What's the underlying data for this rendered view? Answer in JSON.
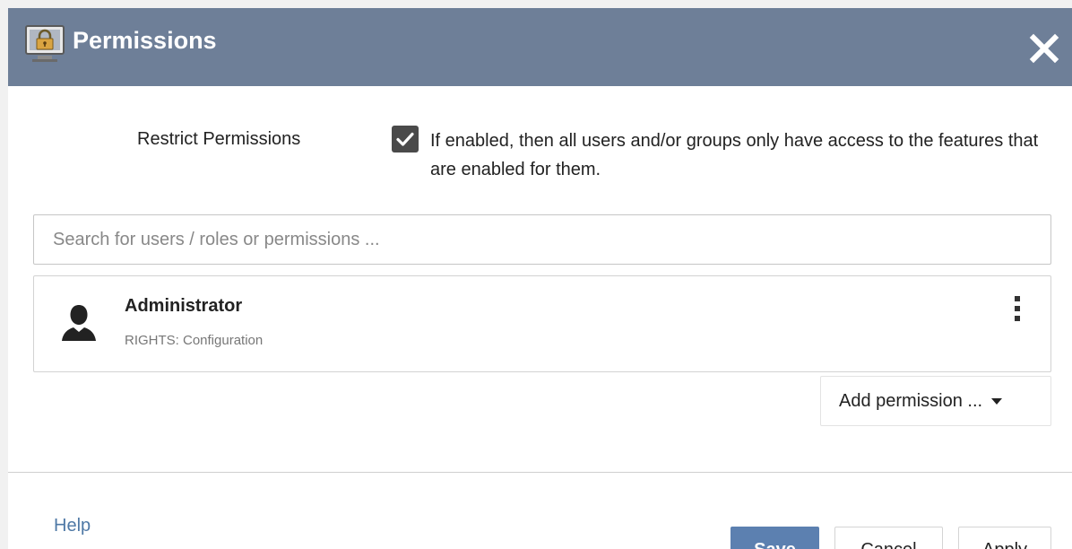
{
  "dialog": {
    "title": "Permissions",
    "title_icon": "padlock-monitor-icon",
    "close_icon": "close-icon"
  },
  "restrict": {
    "label": "Restrict Permissions",
    "checked": true,
    "description": "If enabled, then all users and/or groups only have access to the features that are enabled for them."
  },
  "search": {
    "placeholder": "Search for users / roles or permissions ...",
    "value": ""
  },
  "entries": [
    {
      "name": "Administrator",
      "rights": "RIGHTS: Configuration",
      "icon": "user-icon"
    }
  ],
  "add_permission": {
    "label": "Add permission ..."
  },
  "footer": {
    "help_label": "Help",
    "save_label": "Save",
    "cancel_label": "Cancel",
    "apply_label": "Apply"
  },
  "colors": {
    "titlebar": "#6e7f98",
    "primary_button": "#5c80b0",
    "link": "#4f79a6",
    "checkbox": "#4a4a4a"
  }
}
